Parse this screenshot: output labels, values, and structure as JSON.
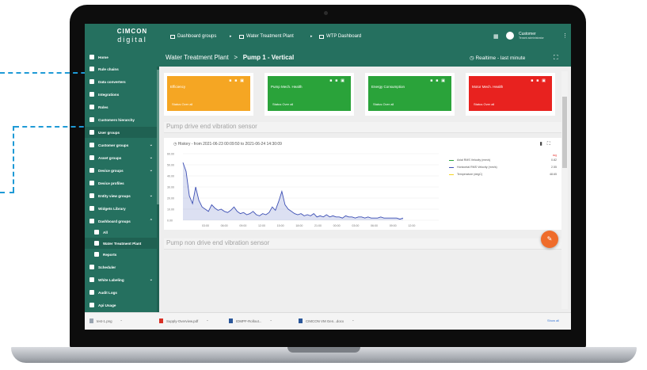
{
  "topbar": {
    "logo_line1": "CIMCON",
    "logo_line2": "digital",
    "breadcrumbs": [
      "Dashboard groups",
      "Water Treatment Plant",
      "WTP Dashboard"
    ],
    "user_name": "Customer",
    "user_role": "Tenant administrator"
  },
  "sidebar": {
    "items": [
      {
        "label": "Home",
        "icon": "home-icon"
      },
      {
        "label": "Rule chains",
        "icon": "rule-chain-icon"
      },
      {
        "label": "Data converters",
        "icon": "converter-icon"
      },
      {
        "label": "Integrations",
        "icon": "integration-icon"
      },
      {
        "label": "Roles",
        "icon": "roles-icon"
      },
      {
        "label": "Customers hierarchy",
        "icon": "hierarchy-icon"
      },
      {
        "label": "User groups",
        "icon": "users-icon"
      },
      {
        "label": "Customer groups",
        "icon": "customers-icon"
      },
      {
        "label": "Asset groups",
        "icon": "asset-icon"
      },
      {
        "label": "Device groups",
        "icon": "device-icon"
      },
      {
        "label": "Device profiles",
        "icon": "profile-icon"
      },
      {
        "label": "Entity view groups",
        "icon": "entity-view-icon"
      },
      {
        "label": "Widgets Library",
        "icon": "widgets-icon"
      },
      {
        "label": "Dashboard groups",
        "icon": "dashboard-icon"
      },
      {
        "label": "All",
        "icon": "dashboard-all-icon"
      },
      {
        "label": "Water Treatment Plant",
        "icon": "dashboard-wtp-icon"
      },
      {
        "label": "Reports",
        "icon": "reports-icon"
      },
      {
        "label": "Scheduler",
        "icon": "scheduler-icon"
      },
      {
        "label": "White Labeling",
        "icon": "white-label-icon"
      },
      {
        "label": "Audit Logs",
        "icon": "audit-icon"
      },
      {
        "label": "Api Usage",
        "icon": "api-icon"
      }
    ]
  },
  "content_header": {
    "parent": "Water Treatment Plant",
    "separator": ">",
    "current": "Pump 1 - Vertical",
    "realtime": "Realtime - last minute"
  },
  "cards": [
    {
      "title": "Efficiency",
      "status": "Status Over all",
      "color": "#f5a623"
    },
    {
      "title": "Pump Mech. Health",
      "status": "Status Over all",
      "color": "#2aa33a"
    },
    {
      "title": "Energy Consumption",
      "status": "Status Over all",
      "color": "#2aa33a"
    },
    {
      "title": "Motor Mech. Health",
      "status": "Status Over all",
      "color": "#e8221f"
    }
  ],
  "sections": {
    "drive": "Pump drive end vibration sensor",
    "non_drive": "Pump non drive end vibration sensor"
  },
  "history": {
    "label": "History - from 2021-06-23 00:09:50 to 2021-06-24 14:30:09"
  },
  "legend": {
    "unit_header": "avg",
    "items": [
      {
        "name": "Axial RMS Velocity (mm/s)",
        "value": "0.82",
        "color": "#2aa33a"
      },
      {
        "name": "Horizontal RMS Velocity (mm/s)",
        "value": "2.55",
        "color": "#3f51b5"
      },
      {
        "name": "Temperature (degC)",
        "value": "48.65",
        "color": "#f5d623"
      }
    ]
  },
  "taskbar": {
    "downloads": [
      "test-1.png",
      "Supply-Overview.pdf",
      "IDMPF-Rollout...",
      "CIMCON VM Gen...docx"
    ],
    "show_all": "Show all"
  },
  "chart_data": {
    "type": "line",
    "title": "",
    "y_ticks": [
      "60.00",
      "50.00",
      "40.00",
      "30.00",
      "20.00",
      "10.00",
      "0.00"
    ],
    "x_ticks": [
      "03:00",
      "06:00",
      "09:00",
      "12:00",
      "15:00",
      "18:00",
      "21:00",
      "00:00",
      "03:00",
      "06:00",
      "09:00",
      "12:00"
    ],
    "ylim": [
      0,
      60
    ],
    "series": [
      {
        "name": "Horizontal RMS Velocity (mm/s)",
        "color": "#3f51b5",
        "values": [
          52,
          44,
          22,
          15,
          30,
          18,
          12,
          10,
          8,
          14,
          11,
          9,
          10,
          8,
          7,
          9,
          12,
          8,
          6,
          7,
          5,
          6,
          8,
          5,
          4,
          6,
          5,
          7,
          12,
          9,
          17,
          26,
          14,
          10,
          8,
          6,
          5,
          6,
          4,
          5,
          4,
          6,
          3,
          4,
          3,
          5,
          3,
          4,
          3,
          3,
          2,
          4,
          3,
          3,
          2,
          3,
          3,
          2,
          3,
          2,
          2,
          2,
          3,
          2,
          2,
          2,
          2,
          2,
          1,
          2
        ]
      }
    ]
  }
}
